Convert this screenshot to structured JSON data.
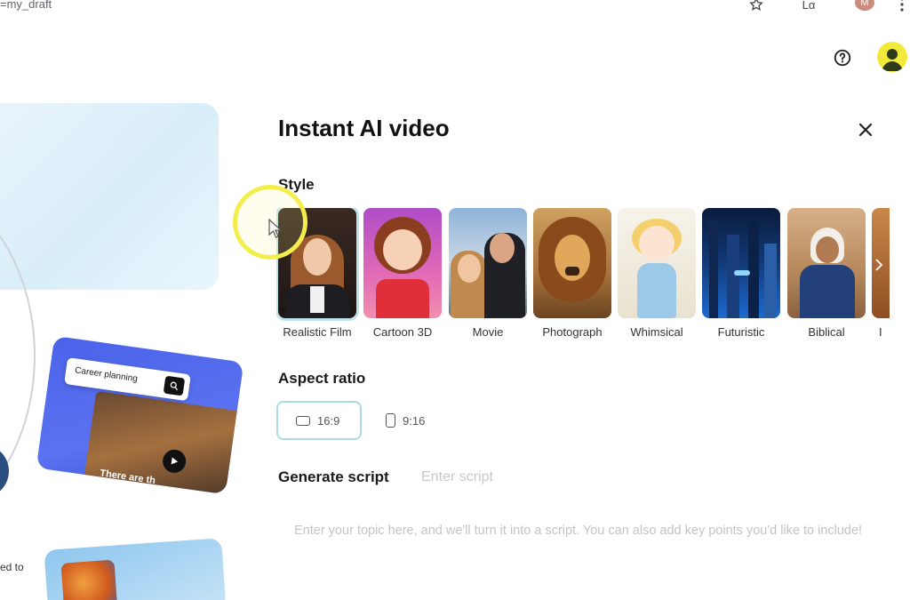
{
  "browser": {
    "url_fragment": "=my_draft",
    "profile_initial": "M",
    "lang_label": "Lα"
  },
  "colors": {
    "accent_selected_border": "#a9dde3",
    "avatar_bg": "#f2ea3a",
    "promo_blue": "#4a62e8",
    "cursor_highlight": "#f3ee4c"
  },
  "header": {
    "help_icon": "question-circle-icon",
    "avatar_icon": "user-avatar-icon"
  },
  "background": {
    "promo_search_text": "Career planning",
    "promo_caption": "There are th",
    "side_text": "ed to"
  },
  "dialog": {
    "title": "Instant AI video",
    "close_icon": "close-icon",
    "style": {
      "label": "Style",
      "selected": "Realistic Film",
      "items": [
        {
          "label": "Realistic Film"
        },
        {
          "label": "Cartoon 3D"
        },
        {
          "label": "Movie"
        },
        {
          "label": "Photograph"
        },
        {
          "label": "Whimsical"
        },
        {
          "label": "Futuristic"
        },
        {
          "label": "Biblical"
        },
        {
          "label": "I"
        }
      ],
      "next_icon": "chevron-right-icon"
    },
    "aspect_ratio": {
      "label": "Aspect ratio",
      "selected": "16:9",
      "options": [
        {
          "label": "16:9"
        },
        {
          "label": "9:16"
        }
      ]
    },
    "script": {
      "label": "Generate script",
      "mode_label": "Enter script",
      "placeholder": "Enter your topic here, and we'll turn it into a script. You can also add key points you'd like to include!",
      "value": ""
    }
  }
}
